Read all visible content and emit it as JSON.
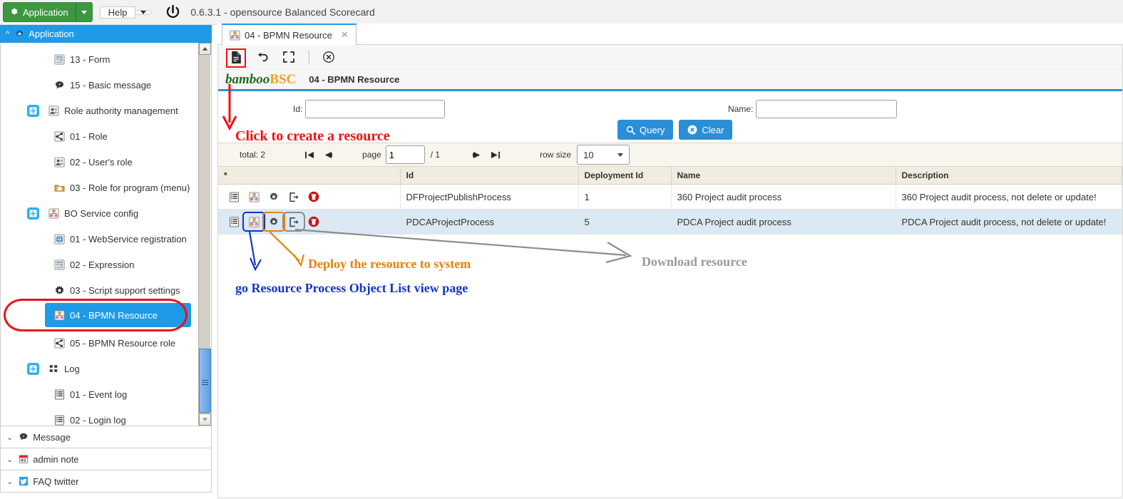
{
  "topbar": {
    "app_button_label": "Application",
    "help_button_label": "Help",
    "app_title": "0.6.3.1 - opensource Balanced Scorecard",
    "gear_icon": "gear-icon",
    "power_icon": "power-icon",
    "caret_icon": "chevron-down-icon"
  },
  "sidebar": {
    "header": {
      "label": "Application",
      "icon": "gear-icon",
      "chevron": "chevron-up-icon"
    },
    "items": [
      {
        "label": "13 - Form",
        "level": 2,
        "icon": "form-icon",
        "selected": false
      },
      {
        "label": "15 - Basic message",
        "level": 2,
        "icon": "message-icon",
        "selected": false
      },
      {
        "label": "Role authority management",
        "level": 1,
        "icon": "users-icon",
        "expander": "plus-box-icon",
        "selected": false
      },
      {
        "label": "01 - Role",
        "level": 2,
        "icon": "share-icon",
        "selected": false
      },
      {
        "label": "02 - User's role",
        "level": 2,
        "icon": "users-icon",
        "selected": false
      },
      {
        "label": "03 - Role for program (menu)",
        "level": 2,
        "icon": "folder-icon",
        "selected": false
      },
      {
        "label": "BO Service config",
        "level": 1,
        "icon": "sitemap-icon",
        "expander": "plus-box-icon",
        "selected": false
      },
      {
        "label": "01 - WebService registration",
        "level": 2,
        "icon": "globe-icon",
        "selected": false
      },
      {
        "label": "02 - Expression",
        "level": 2,
        "icon": "form-icon",
        "selected": false
      },
      {
        "label": "03 - Script support settings",
        "level": 2,
        "icon": "gear-icon",
        "selected": false
      },
      {
        "label": "04 - BPMN Resource",
        "level": 2,
        "icon": "sitemap-icon",
        "selected": true
      },
      {
        "label": "05 - BPMN Resource role",
        "level": 2,
        "icon": "share-icon",
        "selected": false
      },
      {
        "label": "Log",
        "level": 1,
        "icon": "grid-icon",
        "expander": "plus-box-icon",
        "selected": false
      },
      {
        "label": "01 - Event log",
        "level": 2,
        "icon": "list-icon",
        "selected": false
      },
      {
        "label": "02 - Login log",
        "level": 2,
        "icon": "list-icon",
        "selected": false
      }
    ],
    "footer_items": [
      {
        "label": "Message",
        "icon": "message-icon",
        "chevron": "chevron-down-icon"
      },
      {
        "label": "admin note",
        "icon": "calendar-icon",
        "chevron": "chevron-down-icon"
      },
      {
        "label": "FAQ twitter",
        "icon": "twitter-icon",
        "chevron": "chevron-down-icon"
      }
    ]
  },
  "tab": {
    "label": "04 - BPMN Resource",
    "icon": "sitemap-icon",
    "close_icon": "close-icon"
  },
  "toolbar": {
    "buttons": [
      {
        "name": "new-document-button",
        "icon": "document-icon",
        "highlighted": true
      },
      {
        "name": "undo-button",
        "icon": "undo-icon",
        "highlighted": false
      },
      {
        "name": "expand-button",
        "icon": "expand-icon",
        "highlighted": false
      },
      {
        "name": "close-button",
        "icon": "close-circle-icon",
        "highlighted": false
      }
    ]
  },
  "brand": {
    "part1": "bamboo",
    "part2": "BSC",
    "page_title": "04 - BPMN Resource"
  },
  "form": {
    "id_label": "Id:",
    "id_value": "",
    "name_label": "Name:",
    "name_value": "",
    "query_label": "Query",
    "query_icon": "search-icon",
    "clear_label": "Clear",
    "clear_icon": "close-circle-icon"
  },
  "pager": {
    "total_label": "total: 2",
    "first_icon": "first-page-icon",
    "prev_icon": "prev-page-icon",
    "page_label": "page",
    "page_value": "1",
    "page_of": "/ 1",
    "next_icon": "next-page-icon",
    "last_icon": "last-page-icon",
    "row_size_label": "row size",
    "row_size_value": "10"
  },
  "table": {
    "headers": [
      "*",
      "Id",
      "Deployment Id",
      "Name",
      "Description"
    ],
    "row_icons": [
      "list-view-icon",
      "process-object-icon",
      "deploy-icon",
      "download-icon",
      "delete-icon"
    ],
    "rows": [
      {
        "id": "DFProjectPublishProcess",
        "deployment_id": "1",
        "name": "360 Project audit process",
        "description": "360 Project audit process, not delete or update!"
      },
      {
        "id": "PDCAProjectProcess",
        "deployment_id": "5",
        "name": "PDCA Project audit process",
        "description": "PDCA Project audit process, not delete or update!"
      }
    ]
  },
  "annotations": {
    "create": "Click to create a resource",
    "deploy": "Deploy the resource to system",
    "download": "Download resource",
    "go_list": "go Resource Process Object List view page"
  },
  "colors": {
    "accent_blue": "#1e9ae7",
    "green": "#3c9740",
    "annotation_red": "#ee1111",
    "annotation_orange": "#e8820c",
    "annotation_blue": "#1533cc",
    "annotation_gray": "#9a9a9a"
  }
}
